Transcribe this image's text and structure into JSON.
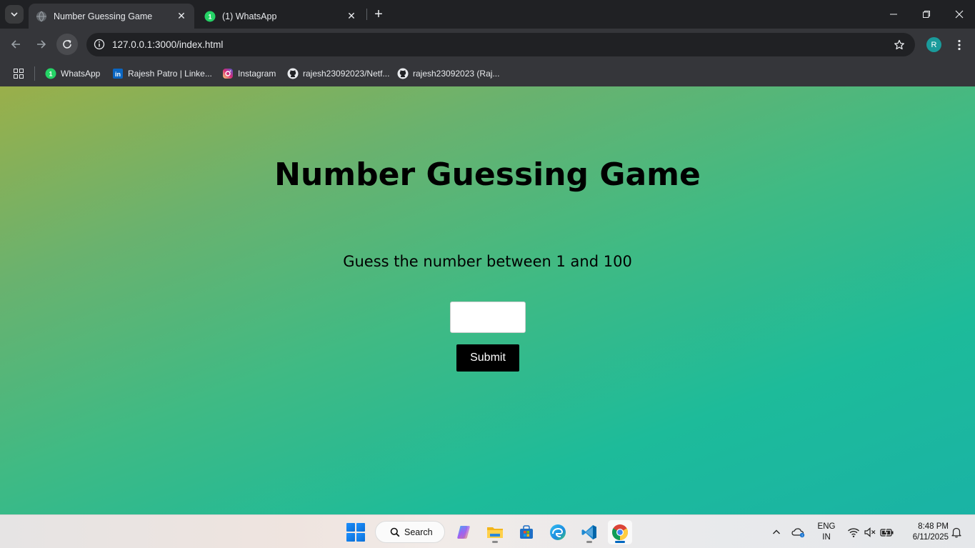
{
  "browser": {
    "tabs": [
      {
        "title": "Number Guessing Game",
        "active": true,
        "icon": "globe-icon"
      },
      {
        "title": "(1) WhatsApp",
        "active": false,
        "icon": "whatsapp-icon"
      }
    ],
    "url": "127.0.0.1:3000/index.html",
    "profile_initial": "R",
    "bookmarks": [
      {
        "label": "WhatsApp",
        "icon": "whatsapp-icon"
      },
      {
        "label": "Rajesh Patro | Linke...",
        "icon": "linkedin-icon"
      },
      {
        "label": "Instagram",
        "icon": "instagram-icon"
      },
      {
        "label": "rajesh23092023/Netf...",
        "icon": "github-icon"
      },
      {
        "label": "rajesh23092023 (Raj...",
        "icon": "github-icon"
      }
    ]
  },
  "page": {
    "title": "Number Guessing Game",
    "instruction": "Guess the number between 1 and 100",
    "guess_input": {
      "value": "",
      "placeholder": ""
    },
    "submit_label": "Submit"
  },
  "taskbar": {
    "search_label": "Search",
    "apps": [
      "copilot-icon",
      "file-explorer-icon",
      "microsoft-store-icon",
      "edge-icon",
      "vscode-icon",
      "chrome-icon"
    ],
    "language": {
      "line1": "ENG",
      "line2": "IN"
    },
    "time": "8:48 PM",
    "date": "6/11/2025"
  },
  "colors": {
    "page_gradient_start": "#9aaf4a",
    "page_gradient_end": "#1ab3a5",
    "button_bg": "#000000",
    "browser_dark": "#202124",
    "browser_toolbar": "#35363a"
  }
}
